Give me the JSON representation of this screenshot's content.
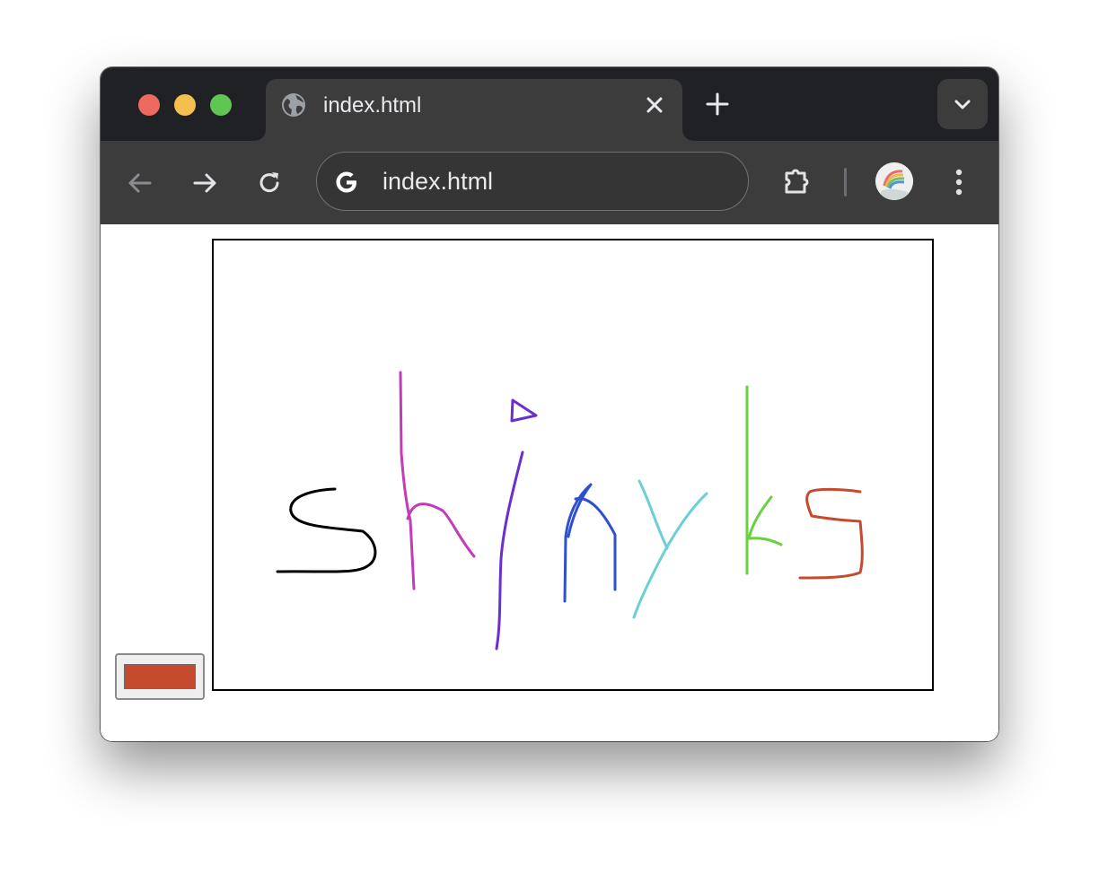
{
  "browser": {
    "tab": {
      "title": "index.html",
      "icon": "globe-icon"
    },
    "address_bar": {
      "url": "index.html",
      "icon": "google-g-icon"
    },
    "toolbar_icons": [
      "back-arrow-icon",
      "forward-arrow-icon",
      "reload-icon",
      "extensions-puzzle-icon",
      "profile-avatar",
      "more-vert-icon"
    ],
    "traffic_lights": {
      "close": "#ec6a5e",
      "minimize": "#f4bf4f",
      "maximize": "#61c554"
    }
  },
  "page": {
    "color_picker": {
      "value": "#c64a2e"
    },
    "drawing": {
      "description_colors": [
        "#000000",
        "#c23bb8",
        "#6a2fd1",
        "#2e4fd1",
        "#6ccfd6",
        "#66d23c",
        "#c64a2e"
      ]
    }
  }
}
